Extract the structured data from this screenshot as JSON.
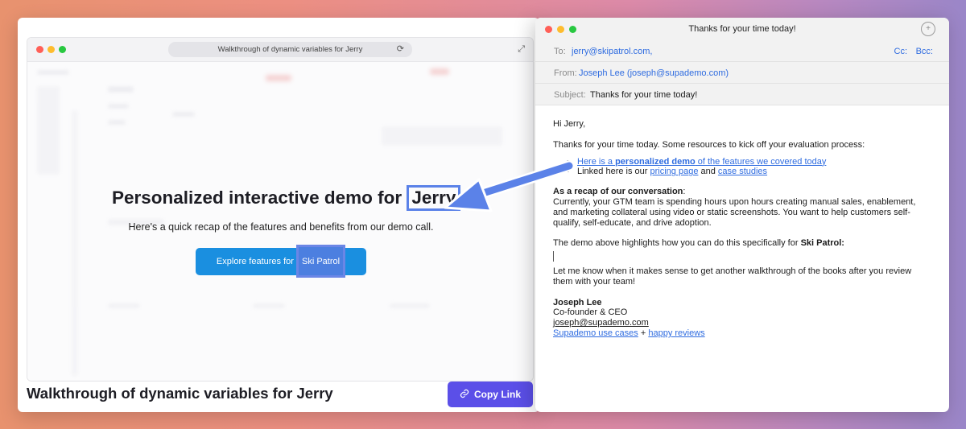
{
  "demo": {
    "url_title": "Walkthrough of dynamic variables for Jerry",
    "heading_prefix": "Personalized interactive demo for ",
    "heading_name": "Jerry",
    "subtitle": "Here's a quick recap of the features and benefits from our demo call.",
    "button_prefix": "Explore features for ",
    "button_company": "Ski Patrol"
  },
  "page": {
    "title": "Walkthrough of dynamic variables for Jerry",
    "copy_link_label": "Copy Link"
  },
  "mail": {
    "window_title": "Thanks for your time today!",
    "to_label": "To:",
    "to_value": "jerry@skipatrol.com,",
    "cc_label": "Cc:",
    "bcc_label": "Bcc:",
    "from_label": "From:",
    "from_value": "Joseph Lee (joseph@supademo.com)",
    "subject_label": "Subject:",
    "subject_value": "Thanks for your time today!",
    "greeting": "Hi Jerry,",
    "intro": "Thanks for your time today. Some resources to kick off your evaluation process:",
    "bullet1_pre": "Here is a ",
    "bullet1_bold": "personalized demo",
    "bullet1_post": " of the features we covered today",
    "bullet2_pre": "Linked here is our ",
    "bullet2_link1": "pricing page",
    "bullet2_mid": " and ",
    "bullet2_link2": "case studies",
    "recap_heading": "As a recap of our conversation",
    "recap_colon": ":",
    "recap_text": "Currently, your GTM team is spending hours upon hours creating manual sales, enablement, and marketing collateral using video or static screenshots. You want to help customers self-qualify, self-educate, and drive adoption.",
    "demo_line_pre": "The demo above highlights how you can do this specifically for ",
    "demo_line_bold": "Ski Patrol:",
    "closing": "Let me know when it makes sense to get another walkthrough of the books after you review them with your team!",
    "sig_name": "Joseph Lee",
    "sig_title": "Co-founder & CEO",
    "sig_email": "joseph@supademo.com",
    "sig_link1": "Supademo use cases",
    "sig_plus": " + ",
    "sig_link2": "happy reviews"
  },
  "colors": {
    "highlight": "#5b82e8",
    "arrow": "#5b82e8",
    "copy_button": "#5b4fe8",
    "demo_button": "#1a8fe0",
    "link": "#2f6ce0"
  },
  "icons": [
    "reload-icon",
    "expand-icon",
    "link-icon",
    "add-contact-icon",
    "arrow-icon"
  ]
}
